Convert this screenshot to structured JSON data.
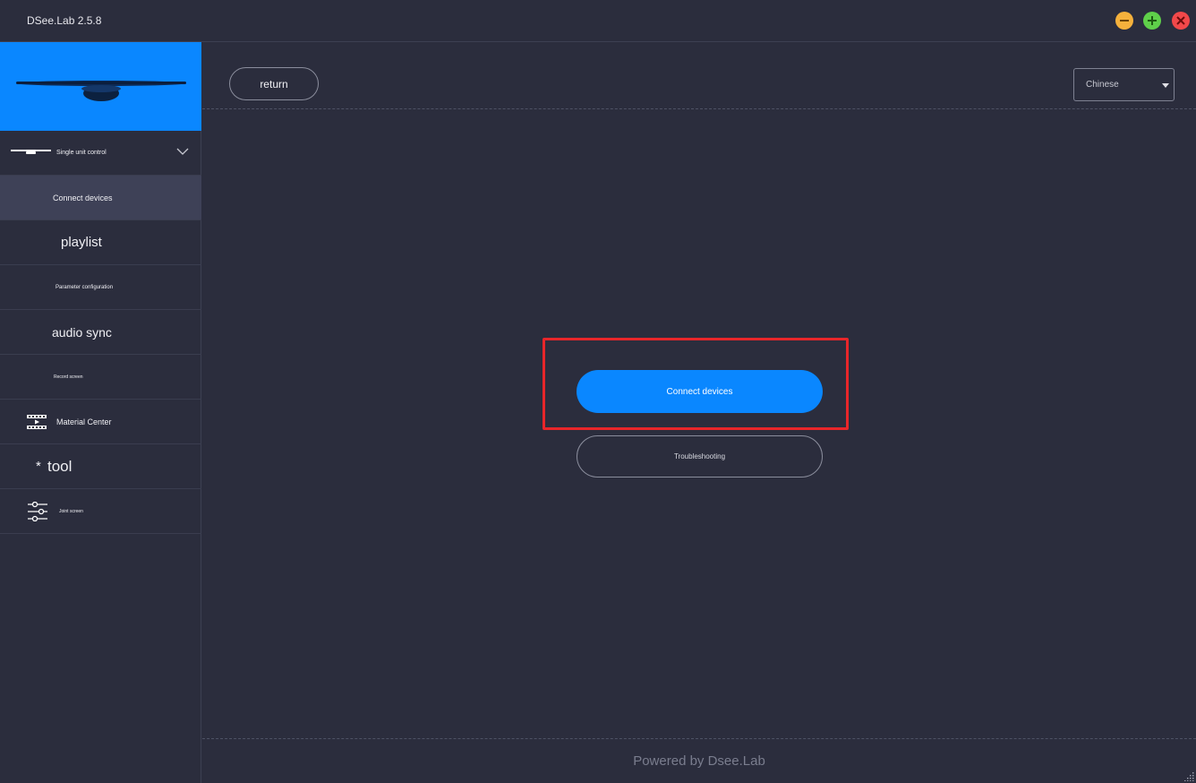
{
  "window": {
    "title": "DSee.Lab 2.5.8"
  },
  "sidebar": {
    "items": [
      {
        "label": "Single unit control",
        "icon": "hologram-fan-icon"
      },
      {
        "label": "Connect devices"
      },
      {
        "label": "playlist"
      },
      {
        "label": "Parameter configuration"
      },
      {
        "label": "audio sync"
      },
      {
        "label": "Record screen"
      },
      {
        "label": "Material Center",
        "icon": "film-icon"
      },
      {
        "label": "tool",
        "icon": "asterisk-icon",
        "icon_text": "*"
      },
      {
        "label": "Joint screen",
        "icon": "sliders-icon"
      }
    ]
  },
  "toolbar": {
    "return_label": "return",
    "language_value": "Chinese"
  },
  "main": {
    "connect_label": "Connect devices",
    "troubleshoot_label": "Troubleshooting"
  },
  "footer": {
    "text": "Powered by Dsee.Lab"
  },
  "colors": {
    "accent": "#0a87ff",
    "background": "#2b2d3d",
    "highlight": "#e8262a",
    "active_item": "#3e4157"
  }
}
